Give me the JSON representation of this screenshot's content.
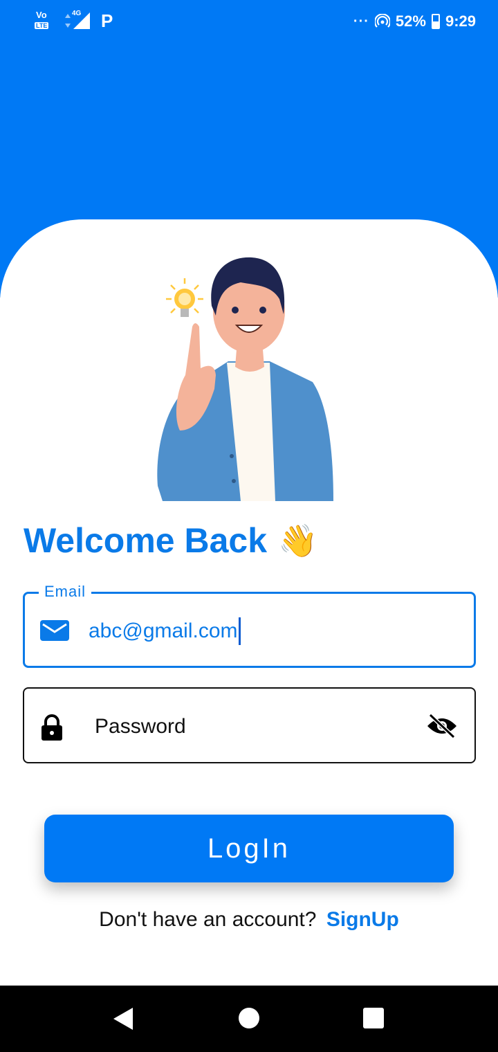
{
  "status_bar": {
    "volte": "Vo",
    "lte": "LTE",
    "network": "4G",
    "more": "···",
    "battery_percent": "52%",
    "time": "9:29"
  },
  "login": {
    "welcome_title": "Welcome Back",
    "wave_emoji": "👋",
    "email_label": "Email",
    "email_value": "abc@gmail.com",
    "password_placeholder": "Password",
    "login_button": "LogIn",
    "signup_prompt": "Don't have an account?",
    "signup_link": "SignUp"
  },
  "icons": {
    "email": "mail-icon",
    "password": "lock-icon",
    "visibility": "eye-off-icon",
    "nav_back": "back-triangle-icon",
    "nav_home": "home-circle-icon",
    "nav_recents": "recents-square-icon"
  },
  "colors": {
    "primary": "#0079f5",
    "text_blue": "#0a7ae8",
    "text_dark": "#111111"
  }
}
